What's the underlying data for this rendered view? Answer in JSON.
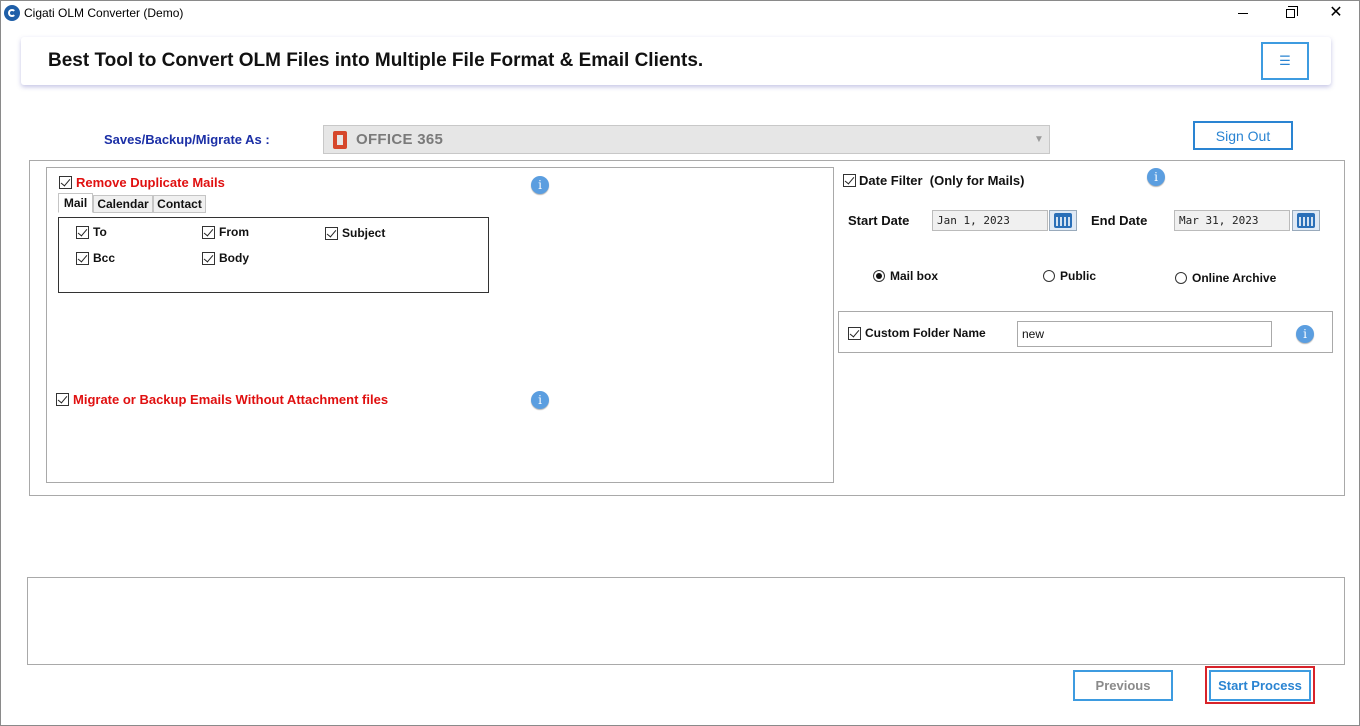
{
  "window": {
    "title": "Cigati OLM Converter (Demo)",
    "controls": {
      "minimize": "minimize",
      "maximize": "restore",
      "close": "✕"
    }
  },
  "header": {
    "banner_title": "Best Tool to Convert OLM Files into Multiple File Format & Email Clients.",
    "menu_icon": "☰"
  },
  "save_as": {
    "label": "Saves/Backup/Migrate As :",
    "selected": "OFFICE 365",
    "icon": "office-365-icon"
  },
  "sign_out_label": "Sign Out",
  "duplicate": {
    "label": "Remove Duplicate Mails",
    "checked": true,
    "tabs": [
      {
        "label": "Mail",
        "active": true
      },
      {
        "label": "Calendar",
        "active": false
      },
      {
        "label": "Contact",
        "active": false
      }
    ],
    "fields": [
      {
        "label": "To",
        "checked": true
      },
      {
        "label": "From",
        "checked": true
      },
      {
        "label": "Subject",
        "checked": true
      },
      {
        "label": "Bcc",
        "checked": true
      },
      {
        "label": "Body",
        "checked": true
      }
    ]
  },
  "attachments": {
    "label": "Migrate or Backup Emails Without Attachment files",
    "checked": true
  },
  "date_filter": {
    "label": "Date Filter  (Only for Mails)",
    "checked": true,
    "start_label": "Start Date",
    "start_value": "Jan 1, 2023",
    "end_label": "End Date",
    "end_value": "Mar 31, 2023"
  },
  "mailbox_options": [
    {
      "label": "Mail box",
      "selected": true
    },
    {
      "label": "Public",
      "selected": false
    },
    {
      "label": "Online Archive",
      "selected": false
    }
  ],
  "custom_folder": {
    "label": "Custom Folder Name",
    "checked": true,
    "value": "new"
  },
  "info_glyph": "i",
  "footer": {
    "previous_label": "Previous",
    "start_label": "Start Process"
  },
  "colors": {
    "accent": "#2a84d2",
    "warning_text": "#e01010",
    "label_blue": "#1b2fa6",
    "highlight_outline": "#d8232a"
  }
}
